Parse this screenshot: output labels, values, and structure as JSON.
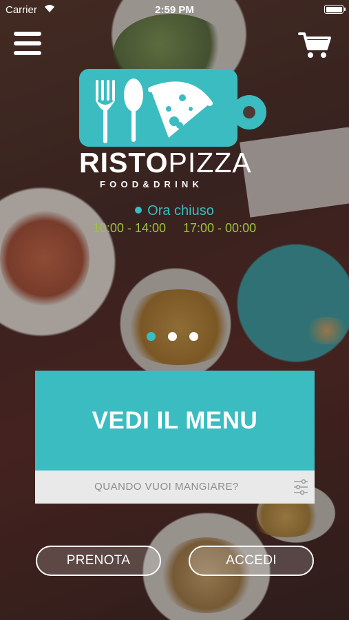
{
  "status_bar": {
    "carrier": "Carrier",
    "time": "2:59 PM"
  },
  "logo": {
    "title_bold": "RISTO",
    "title_light": "PIZZA",
    "subtitle": "FOOD&DRINK"
  },
  "opening": {
    "status": "Ora chiuso",
    "hours": [
      "10:00 - 14:00",
      "17:00 - 00:00"
    ]
  },
  "pager": {
    "pages": 3,
    "active_index": 0
  },
  "menu_card": {
    "label": "VEDI IL MENU"
  },
  "when_bar": {
    "label": "QUANDO VUOI MANGIARE?"
  },
  "buttons": {
    "book": "PRENOTA",
    "login": "ACCEDI"
  },
  "colors": {
    "accent": "#3bbcc1",
    "hours": "#9ec43c",
    "bar": "#e9e9ea"
  },
  "icons": [
    "wifi-icon",
    "battery-icon",
    "hamburger-menu-icon",
    "cart-icon",
    "fork-icon",
    "spoon-icon",
    "pizza-slice-icon",
    "filter-sliders-icon"
  ]
}
